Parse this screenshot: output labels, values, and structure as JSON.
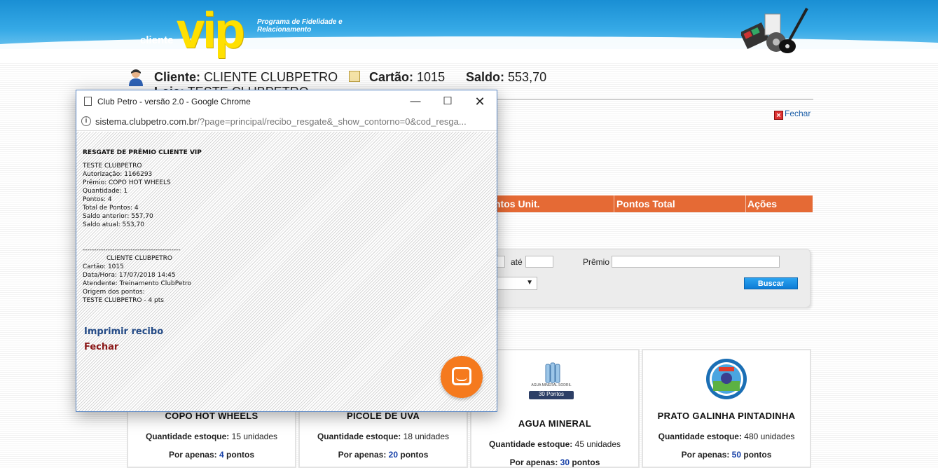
{
  "banner": {
    "logo_small": "cliente",
    "logo_big": "vip",
    "tagline": "Programa de Fidelidade e Relacionamento"
  },
  "client": {
    "cliente_label": "Cliente:",
    "cliente_value": "CLIENTE CLUBPETRO",
    "cartao_label": "Cartão:",
    "cartao_value": "1015",
    "saldo_label": "Saldo:",
    "saldo_value": "553,70",
    "loja_label": "Loja:",
    "loja_value": "TESTE CLUBPETRO"
  },
  "page": {
    "fechar": "Fechar"
  },
  "table": {
    "headers": [
      "ntos Unit.",
      "Pontos Total",
      "Ações"
    ]
  },
  "filter": {
    "ate_label": "até",
    "premio_label": "Prêmio",
    "select_value": "e",
    "buscar": "Buscar"
  },
  "products": [
    {
      "name": "COPO HOT WHEELS",
      "qty_label": "Quantidade estoque:",
      "qty": "15 unidades",
      "price_label": "Por apenas:",
      "points": "4",
      "points_suffix": "pontos"
    },
    {
      "name": "PICOLE DE UVA",
      "qty_label": "Quantidade estoque:",
      "qty": "18 unidades",
      "price_label": "Por apenas:",
      "points": "20",
      "points_suffix": "pontos"
    },
    {
      "name": "AGUA MINERAL",
      "qty_label": "Quantidade estoque:",
      "qty": "45 unidades",
      "price_label": "Por apenas:",
      "points": "30",
      "points_suffix": "pontos",
      "badge_text": "AGUA MINERAL SODRIL",
      "badge_points": "30 Pontos"
    },
    {
      "name": "PRATO GALINHA PINTADINHA",
      "qty_label": "Quantidade estoque:",
      "qty": "480 unidades",
      "price_label": "Por apenas:",
      "points": "50",
      "points_suffix": "pontos"
    }
  ],
  "popup": {
    "title": "Club Petro - versão 2.0 - Google Chrome",
    "url_host": "sistema.clubpetro.com.br",
    "url_path": "/?page=principal/recibo_resgate&_show_contorno=0&cod_resga...",
    "receipt": {
      "heading": "RESGATE DE PRÊMIO CLIENTE VIP",
      "lines1": [
        "TESTE CLUBPETRO",
        "Autorização: 1166293",
        "Prêmio: COPO HOT WHEELS",
        "Quantidade: 1",
        "Pontos: 4",
        "Total de Pontos: 4",
        "Saldo anterior: 557,70",
        "Saldo atual: 553,70"
      ],
      "divider": "-------------------------------------------",
      "client_name": "CLIENTE CLUBPETRO",
      "lines2": [
        "Cartão: 1015",
        "Data/Hora: 17/07/2018 14:45",
        "Atendente: Treinamento ClubPetro",
        "Origem dos pontos:",
        "TESTE CLUBPETRO - 4 pts"
      ]
    },
    "print_link": "Imprimir recibo",
    "close_link": "Fechar"
  },
  "colors": {
    "accent_orange": "#e56a35",
    "link_blue": "#1640a8",
    "chat_orange": "#f57a1e"
  }
}
